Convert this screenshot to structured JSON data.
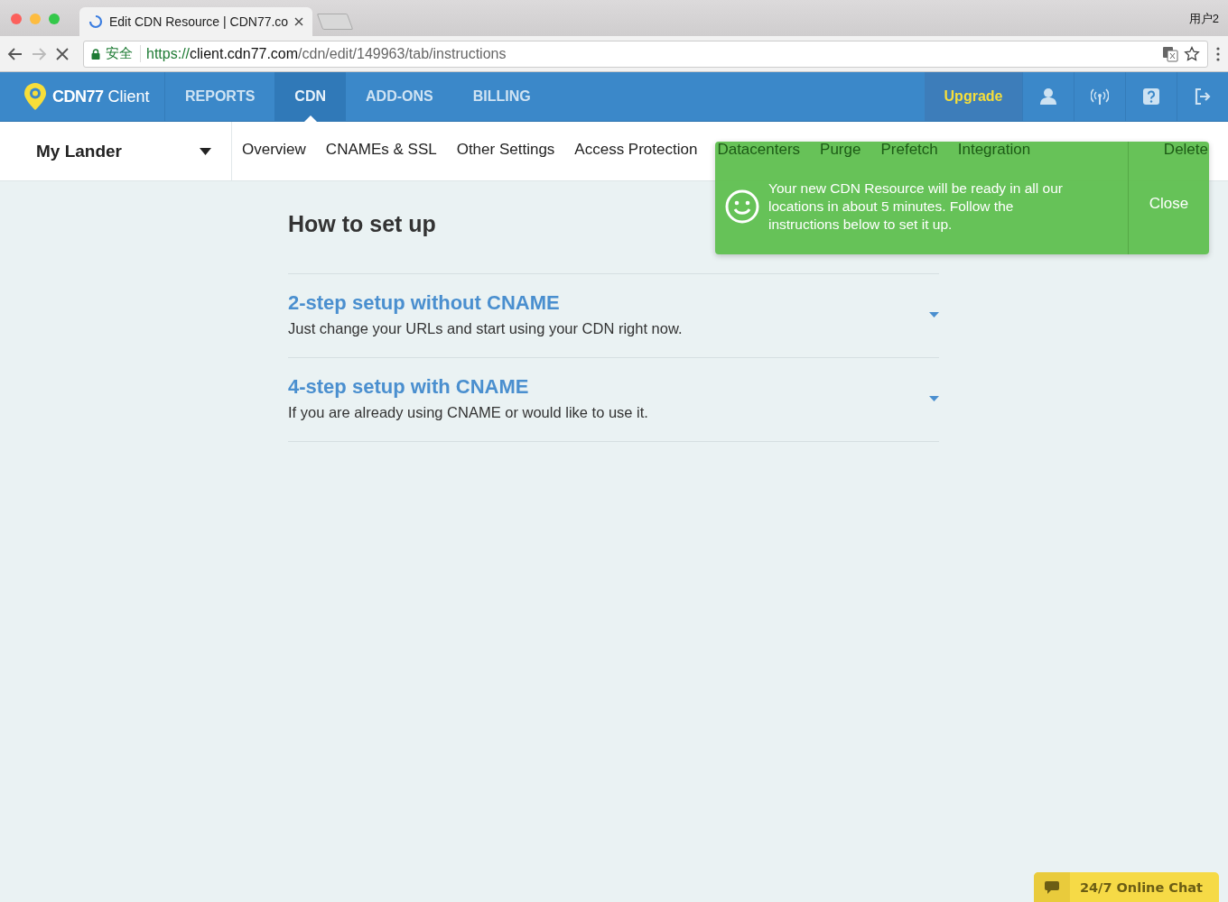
{
  "browser": {
    "tab_title": "Edit CDN Resource | CDN77.co",
    "secure_label": "安全",
    "url_scheme": "https://",
    "url_host": "client.cdn77.com",
    "url_path": "/cdn/edit/149963/tab/instructions",
    "profile": "用户2"
  },
  "header": {
    "brand": "CDN77",
    "brand_suffix": "Client",
    "upgrade": "Upgrade",
    "nav": [
      {
        "label": "REPORTS",
        "selected": false
      },
      {
        "label": "CDN",
        "selected": true
      },
      {
        "label": "ADD-ONS",
        "selected": false
      },
      {
        "label": "BILLING",
        "selected": false
      }
    ]
  },
  "subnav": {
    "resource": "My Lander",
    "tabs": [
      {
        "label": "Overview",
        "selected": false
      },
      {
        "label": "CNAMEs & SSL",
        "selected": false
      },
      {
        "label": "Other Settings",
        "selected": false
      },
      {
        "label": "Access Protection",
        "selected": false
      },
      {
        "label": "Datacenters",
        "selected": false
      },
      {
        "label": "Purge",
        "selected": false
      },
      {
        "label": "Prefetch",
        "selected": false
      },
      {
        "label": "Integration",
        "selected": false
      }
    ],
    "end_tab": {
      "label": "Delete",
      "selected": false
    }
  },
  "toast": {
    "message": "Your new CDN Resource will be ready in all our locations in about 5 minutes. Follow the instructions below to set it up.",
    "close": "Close"
  },
  "content": {
    "heading": "How to set up",
    "sections": [
      {
        "title": "2-step setup without CNAME",
        "description": "Just change your URLs and start using your CDN right now.",
        "expanded": false
      },
      {
        "title": "4-step setup with CNAME",
        "description": "If you are already using CNAME or would like to use it.",
        "expanded": false
      }
    ]
  },
  "chat": {
    "label": "24/7 Online Chat"
  }
}
